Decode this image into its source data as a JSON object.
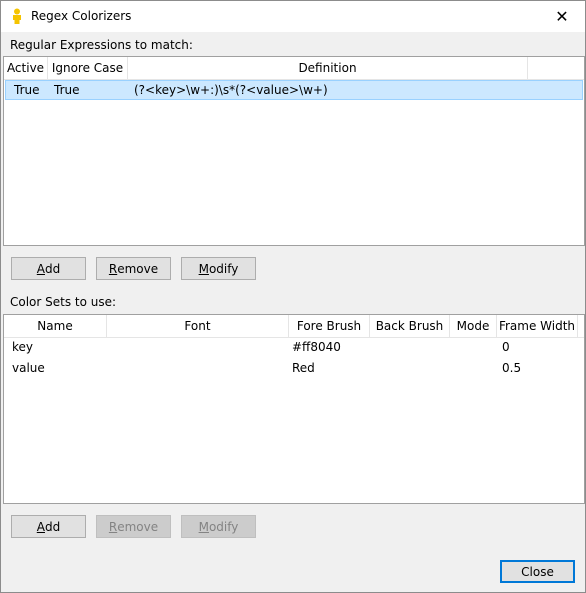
{
  "window": {
    "title": "Regex Colorizers"
  },
  "regex_section": {
    "label": "Regular Expressions to match:",
    "columns": [
      "Active",
      "Ignore Case",
      "Definition"
    ],
    "rows": [
      {
        "active": "True",
        "ignore_case": "True",
        "definition": "(?<key>\\w+:)\\s*(?<value>\\w+)",
        "selected": true
      }
    ],
    "buttons": {
      "add_prefix": "",
      "add_mn": "A",
      "add_rest": "dd",
      "remove_mn": "R",
      "remove_rest": "emove",
      "modify_mn": "M",
      "modify_rest": "odify"
    }
  },
  "colorsets_section": {
    "label": "Color Sets to use:",
    "columns": [
      "Name",
      "Font",
      "Fore Brush",
      "Back Brush",
      "Mode",
      "Frame Width"
    ],
    "rows": [
      {
        "name": "key",
        "font": "",
        "fore_brush": "#ff8040",
        "back_brush": "",
        "mode": "",
        "frame_width": "0"
      },
      {
        "name": "value",
        "font": "",
        "fore_brush": "Red",
        "back_brush": "",
        "mode": "",
        "frame_width": "0.5"
      }
    ],
    "buttons": {
      "add_mn": "A",
      "add_rest": "dd",
      "remove_mn": "R",
      "remove_rest": "emove",
      "modify_mn": "M",
      "modify_rest": "odify"
    }
  },
  "footer": {
    "close_label": "Close"
  },
  "icons": {
    "app": "person-icon",
    "close": "close-icon"
  },
  "colors": {
    "selection": "#cce8ff",
    "accent": "#0078d7"
  }
}
